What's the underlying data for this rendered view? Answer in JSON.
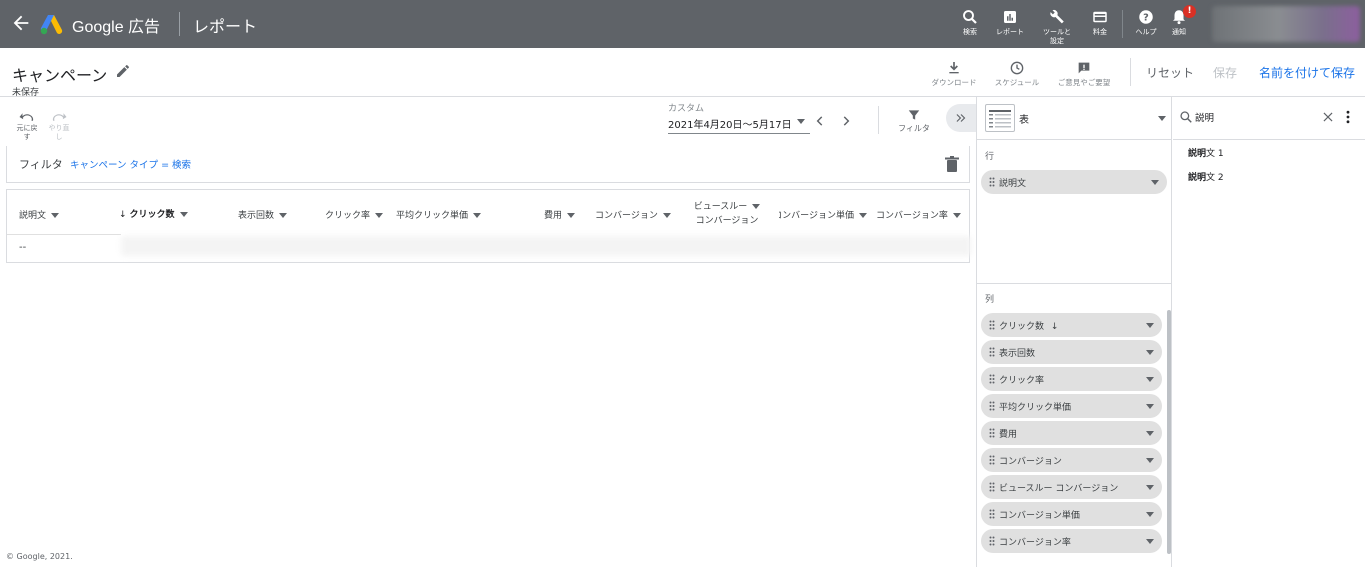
{
  "topbar": {
    "brand": "Google 広告",
    "section": "レポート",
    "buttons": {
      "search": "検索",
      "reports": "レポート",
      "tools_line1": "ツールと",
      "tools_line2": "設定",
      "billing": "料金",
      "help": "ヘルプ",
      "notifications": "通知"
    },
    "notification_badge": "!"
  },
  "header": {
    "title": "キャンペーン",
    "status": "未保存",
    "download": "ダウンロード",
    "schedule": "スケジュール",
    "feedback": "ご意見やご要望",
    "reset": "リセット",
    "save": "保存",
    "save_as": "名前を付けて保存"
  },
  "toolbar": {
    "undo": "元に戻す",
    "redo": "やり直し",
    "date_label": "カスタム",
    "date_range": "2021年4月20日～5月17日",
    "filter": "フィルタ"
  },
  "filter_row": {
    "label": "フィルタ",
    "value": "キャンペーン タイプ = 検索"
  },
  "table": {
    "columns": [
      "説明文",
      "クリック数",
      "表示回数",
      "クリック率",
      "平均クリック単価",
      "費用",
      "コンバージョン",
      "ビュースルー",
      "コンバージョン",
      "コンバージョン単価",
      "コンバージョン率"
    ],
    "first_cell": "--"
  },
  "copyright": "© Google, 2021.",
  "panel": {
    "viz_type": "表",
    "rows_label": "行",
    "row_chips": [
      "説明文"
    ],
    "cols_label": "列",
    "col_chips": [
      "クリック数",
      "表示回数",
      "クリック率",
      "平均クリック単価",
      "費用",
      "コンバージョン",
      "ビュースルー コンバージョン",
      "コンバージョン単価",
      "コンバージョン率"
    ]
  },
  "search_panel": {
    "query": "説明",
    "results": [
      {
        "match": "説明",
        "rest": "文 1"
      },
      {
        "match": "説明",
        "rest": "文 2"
      }
    ]
  },
  "colors": {
    "topbar": "#5f6368",
    "accent": "#1a73e8",
    "badge": "#d93025"
  }
}
